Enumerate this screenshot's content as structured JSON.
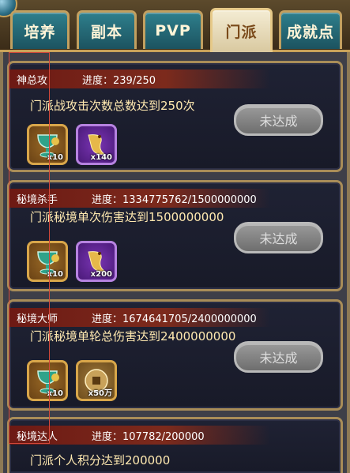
{
  "tabs": [
    "培养",
    "副本",
    "PVP",
    "门派",
    "成就点"
  ],
  "active_tab": "门派",
  "achievements": [
    {
      "title": "神总攻",
      "progress": "进度：239/250",
      "description": "门派战攻击次数总数达到250次",
      "rewards": [
        {
          "icon": "goblet-icon",
          "qty": "x10"
        },
        {
          "icon": "dragon-icon",
          "qty": "x140"
        }
      ],
      "status": "未达成"
    },
    {
      "title": "秘境杀手",
      "progress": "进度：1334775762/1500000000",
      "description": "门派秘境单次伤害达到1500000000",
      "rewards": [
        {
          "icon": "goblet-icon",
          "qty": "x10"
        },
        {
          "icon": "dragon-icon",
          "qty": "x200"
        }
      ],
      "status": "未达成"
    },
    {
      "title": "秘境大师",
      "progress": "进度：1674641705/2400000000",
      "description": "门派秘境单轮总伤害达到2400000000",
      "rewards": [
        {
          "icon": "goblet-icon",
          "qty": "x10"
        },
        {
          "icon": "coin-icon",
          "qty": "x50万"
        }
      ],
      "status": "未达成"
    },
    {
      "title": "秘境达人",
      "progress": "进度：107782/200000",
      "description": "门派个人积分达到200000",
      "rewards": [],
      "status": ""
    }
  ],
  "colors": {
    "tab": "#1c5360",
    "tab_active": "#f4ecd3",
    "ribbon": "#6d1a14",
    "text_gold": "#ffe9b0"
  }
}
